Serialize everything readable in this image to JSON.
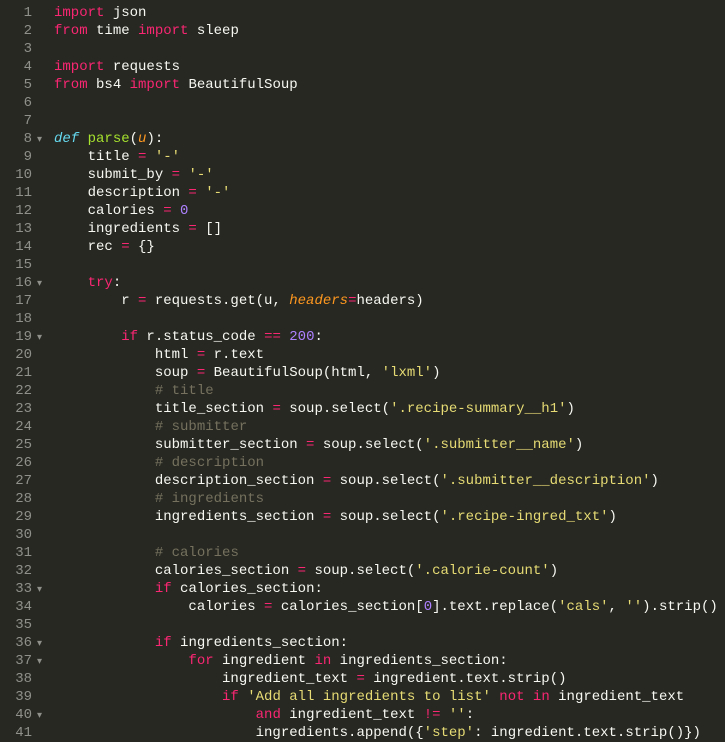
{
  "lines": [
    {
      "num": 1,
      "fold": false,
      "tokens": [
        [
          "k",
          "import"
        ],
        [
          "p",
          " json"
        ]
      ]
    },
    {
      "num": 2,
      "fold": false,
      "tokens": [
        [
          "k",
          "from"
        ],
        [
          "p",
          " time "
        ],
        [
          "k",
          "import"
        ],
        [
          "p",
          " sleep"
        ]
      ]
    },
    {
      "num": 3,
      "fold": false,
      "tokens": [
        [
          "p",
          ""
        ]
      ]
    },
    {
      "num": 4,
      "fold": false,
      "tokens": [
        [
          "k",
          "import"
        ],
        [
          "p",
          " requests"
        ]
      ]
    },
    {
      "num": 5,
      "fold": false,
      "tokens": [
        [
          "k",
          "from"
        ],
        [
          "p",
          " bs4 "
        ],
        [
          "k",
          "import"
        ],
        [
          "p",
          " BeautifulSoup"
        ]
      ]
    },
    {
      "num": 6,
      "fold": false,
      "tokens": [
        [
          "p",
          ""
        ]
      ]
    },
    {
      "num": 7,
      "fold": false,
      "tokens": [
        [
          "p",
          ""
        ]
      ]
    },
    {
      "num": 8,
      "fold": true,
      "tokens": [
        [
          "kd",
          "def"
        ],
        [
          "p",
          " "
        ],
        [
          "nf",
          "parse"
        ],
        [
          "p",
          "("
        ],
        [
          "na",
          "u"
        ],
        [
          "p",
          "):"
        ]
      ]
    },
    {
      "num": 9,
      "fold": false,
      "tokens": [
        [
          "p",
          "    title "
        ],
        [
          "k",
          "="
        ],
        [
          "p",
          " "
        ],
        [
          "s",
          "'-'"
        ]
      ]
    },
    {
      "num": 10,
      "fold": false,
      "tokens": [
        [
          "p",
          "    submit_by "
        ],
        [
          "k",
          "="
        ],
        [
          "p",
          " "
        ],
        [
          "s",
          "'-'"
        ]
      ]
    },
    {
      "num": 11,
      "fold": false,
      "tokens": [
        [
          "p",
          "    description "
        ],
        [
          "k",
          "="
        ],
        [
          "p",
          " "
        ],
        [
          "s",
          "'-'"
        ]
      ]
    },
    {
      "num": 12,
      "fold": false,
      "tokens": [
        [
          "p",
          "    calories "
        ],
        [
          "k",
          "="
        ],
        [
          "p",
          " "
        ],
        [
          "n",
          "0"
        ]
      ]
    },
    {
      "num": 13,
      "fold": false,
      "tokens": [
        [
          "p",
          "    ingredients "
        ],
        [
          "k",
          "="
        ],
        [
          "p",
          " []"
        ]
      ]
    },
    {
      "num": 14,
      "fold": false,
      "tokens": [
        [
          "p",
          "    rec "
        ],
        [
          "k",
          "="
        ],
        [
          "p",
          " {}"
        ]
      ]
    },
    {
      "num": 15,
      "fold": false,
      "tokens": [
        [
          "p",
          ""
        ]
      ]
    },
    {
      "num": 16,
      "fold": true,
      "tokens": [
        [
          "p",
          "    "
        ],
        [
          "k",
          "try"
        ],
        [
          "p",
          ":"
        ]
      ]
    },
    {
      "num": 17,
      "fold": false,
      "tokens": [
        [
          "p",
          "        r "
        ],
        [
          "k",
          "="
        ],
        [
          "p",
          " requests.get(u, "
        ],
        [
          "na",
          "headers"
        ],
        [
          "k",
          "="
        ],
        [
          "p",
          "headers)"
        ]
      ]
    },
    {
      "num": 18,
      "fold": false,
      "tokens": [
        [
          "p",
          ""
        ]
      ]
    },
    {
      "num": 19,
      "fold": true,
      "tokens": [
        [
          "p",
          "        "
        ],
        [
          "k",
          "if"
        ],
        [
          "p",
          " r.status_code "
        ],
        [
          "k",
          "=="
        ],
        [
          "p",
          " "
        ],
        [
          "n",
          "200"
        ],
        [
          "p",
          ":"
        ]
      ]
    },
    {
      "num": 20,
      "fold": false,
      "tokens": [
        [
          "p",
          "            html "
        ],
        [
          "k",
          "="
        ],
        [
          "p",
          " r.text"
        ]
      ]
    },
    {
      "num": 21,
      "fold": false,
      "tokens": [
        [
          "p",
          "            soup "
        ],
        [
          "k",
          "="
        ],
        [
          "p",
          " BeautifulSoup(html, "
        ],
        [
          "s",
          "'lxml'"
        ],
        [
          "p",
          ")"
        ]
      ]
    },
    {
      "num": 22,
      "fold": false,
      "tokens": [
        [
          "p",
          "            "
        ],
        [
          "c",
          "# title"
        ]
      ]
    },
    {
      "num": 23,
      "fold": false,
      "tokens": [
        [
          "p",
          "            title_section "
        ],
        [
          "k",
          "="
        ],
        [
          "p",
          " soup.select("
        ],
        [
          "s",
          "'.recipe-summary__h1'"
        ],
        [
          "p",
          ")"
        ]
      ]
    },
    {
      "num": 24,
      "fold": false,
      "tokens": [
        [
          "p",
          "            "
        ],
        [
          "c",
          "# submitter"
        ]
      ]
    },
    {
      "num": 25,
      "fold": false,
      "tokens": [
        [
          "p",
          "            submitter_section "
        ],
        [
          "k",
          "="
        ],
        [
          "p",
          " soup.select("
        ],
        [
          "s",
          "'.submitter__name'"
        ],
        [
          "p",
          ")"
        ]
      ]
    },
    {
      "num": 26,
      "fold": false,
      "tokens": [
        [
          "p",
          "            "
        ],
        [
          "c",
          "# description"
        ]
      ]
    },
    {
      "num": 27,
      "fold": false,
      "tokens": [
        [
          "p",
          "            description_section "
        ],
        [
          "k",
          "="
        ],
        [
          "p",
          " soup.select("
        ],
        [
          "s",
          "'.submitter__description'"
        ],
        [
          "p",
          ")"
        ]
      ]
    },
    {
      "num": 28,
      "fold": false,
      "tokens": [
        [
          "p",
          "            "
        ],
        [
          "c",
          "# ingredients"
        ]
      ]
    },
    {
      "num": 29,
      "fold": false,
      "tokens": [
        [
          "p",
          "            ingredients_section "
        ],
        [
          "k",
          "="
        ],
        [
          "p",
          " soup.select("
        ],
        [
          "s",
          "'.recipe-ingred_txt'"
        ],
        [
          "p",
          ")"
        ]
      ]
    },
    {
      "num": 30,
      "fold": false,
      "tokens": [
        [
          "p",
          ""
        ]
      ]
    },
    {
      "num": 31,
      "fold": false,
      "tokens": [
        [
          "p",
          "            "
        ],
        [
          "c",
          "# calories"
        ]
      ]
    },
    {
      "num": 32,
      "fold": false,
      "tokens": [
        [
          "p",
          "            calories_section "
        ],
        [
          "k",
          "="
        ],
        [
          "p",
          " soup.select("
        ],
        [
          "s",
          "'.calorie-count'"
        ],
        [
          "p",
          ")"
        ]
      ]
    },
    {
      "num": 33,
      "fold": true,
      "tokens": [
        [
          "p",
          "            "
        ],
        [
          "k",
          "if"
        ],
        [
          "p",
          " calories_section:"
        ]
      ]
    },
    {
      "num": 34,
      "fold": false,
      "tokens": [
        [
          "p",
          "                calories "
        ],
        [
          "k",
          "="
        ],
        [
          "p",
          " calories_section["
        ],
        [
          "n",
          "0"
        ],
        [
          "p",
          "].text.replace("
        ],
        [
          "s",
          "'cals'"
        ],
        [
          "p",
          ", "
        ],
        [
          "s",
          "''"
        ],
        [
          "p",
          ").strip()"
        ]
      ]
    },
    {
      "num": 35,
      "fold": false,
      "tokens": [
        [
          "p",
          ""
        ]
      ]
    },
    {
      "num": 36,
      "fold": true,
      "tokens": [
        [
          "p",
          "            "
        ],
        [
          "k",
          "if"
        ],
        [
          "p",
          " ingredients_section:"
        ]
      ]
    },
    {
      "num": 37,
      "fold": true,
      "tokens": [
        [
          "p",
          "                "
        ],
        [
          "k",
          "for"
        ],
        [
          "p",
          " ingredient "
        ],
        [
          "k",
          "in"
        ],
        [
          "p",
          " ingredients_section:"
        ]
      ]
    },
    {
      "num": 38,
      "fold": false,
      "tokens": [
        [
          "p",
          "                    ingredient_text "
        ],
        [
          "k",
          "="
        ],
        [
          "p",
          " ingredient.text.strip()"
        ]
      ]
    },
    {
      "num": 39,
      "fold": false,
      "tokens": [
        [
          "p",
          "                    "
        ],
        [
          "k",
          "if"
        ],
        [
          "p",
          " "
        ],
        [
          "s",
          "'Add all ingredients to list'"
        ],
        [
          "p",
          " "
        ],
        [
          "k",
          "not"
        ],
        [
          "p",
          " "
        ],
        [
          "k",
          "in"
        ],
        [
          "p",
          " ingredient_text"
        ]
      ]
    },
    {
      "num": 40,
      "fold": true,
      "tokens": [
        [
          "p",
          "                        "
        ],
        [
          "k",
          "and"
        ],
        [
          "p",
          " ingredient_text "
        ],
        [
          "k",
          "!="
        ],
        [
          "p",
          " "
        ],
        [
          "s",
          "''"
        ],
        [
          "p",
          ":"
        ]
      ]
    },
    {
      "num": 41,
      "fold": false,
      "tokens": [
        [
          "p",
          "                        ingredients.append({"
        ],
        [
          "s",
          "'step'"
        ],
        [
          "p",
          ": ingredient.text.strip()})"
        ]
      ]
    }
  ]
}
